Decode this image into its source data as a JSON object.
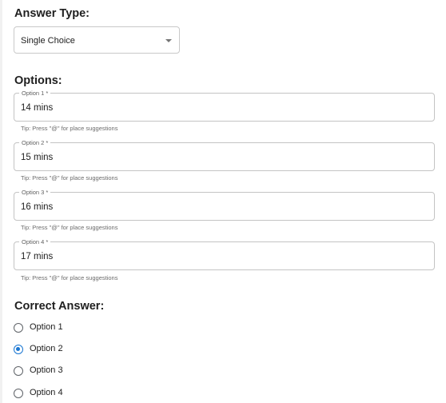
{
  "answer_type": {
    "title": "Answer Type:",
    "selected": "Single Choice",
    "caret_icon": "arrow-drop-down-icon"
  },
  "options": {
    "title": "Options:",
    "items": [
      {
        "label": "Option 1 *",
        "value": "14 mins",
        "tip": "Tip: Press \"@\" for place suggestions"
      },
      {
        "label": "Option 2 *",
        "value": "15 mins",
        "tip": "Tip: Press \"@\" for place suggestions"
      },
      {
        "label": "Option 3 *",
        "value": "16 mins",
        "tip": "Tip: Press \"@\" for place suggestions"
      },
      {
        "label": "Option 4 *",
        "value": "17 mins",
        "tip": "Tip: Press \"@\" for place suggestions"
      }
    ]
  },
  "correct_answer": {
    "title": "Correct Answer:",
    "choices": [
      {
        "label": "Option 1",
        "checked": false
      },
      {
        "label": "Option 2",
        "checked": true
      },
      {
        "label": "Option 3",
        "checked": false
      },
      {
        "label": "Option 4",
        "checked": false
      }
    ],
    "accent_color": "#1976d2"
  }
}
